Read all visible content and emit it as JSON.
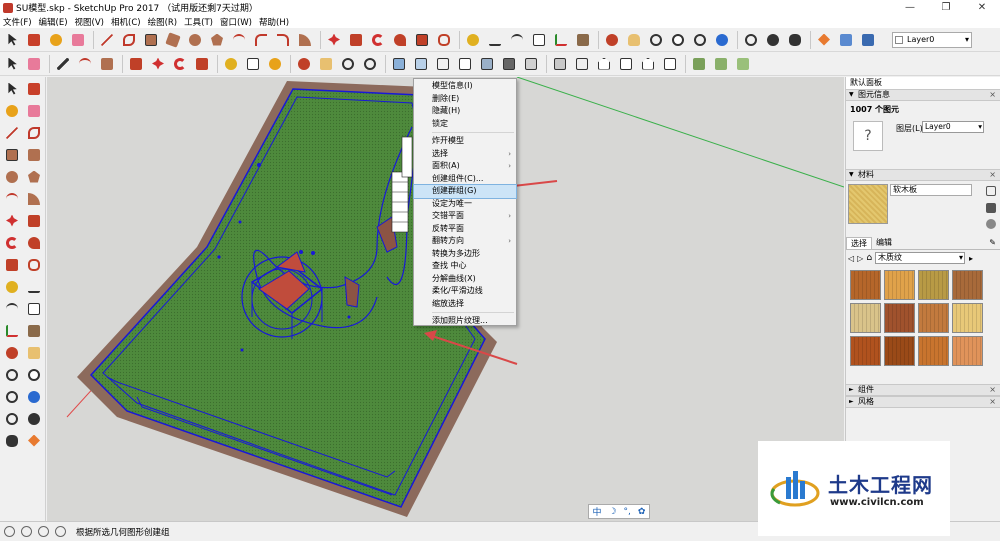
{
  "window": {
    "title": "SU模型.skp - SketchUp Pro 2017 （试用版还剩7天过期）",
    "controls": [
      "—",
      "❐",
      "✕"
    ]
  },
  "menubar": [
    "文件(F)",
    "编辑(E)",
    "视图(V)",
    "相机(C)",
    "绘图(R)",
    "工具(T)",
    "窗口(W)",
    "帮助(H)"
  ],
  "toolbar": {
    "layer_value": "Layer0"
  },
  "context_menu": {
    "items": [
      {
        "label": "模型信息(I)",
        "submenu": false
      },
      {
        "label": "删除(E)",
        "submenu": false
      },
      {
        "label": "隐藏(H)",
        "submenu": false
      },
      {
        "label": "锁定",
        "submenu": false
      },
      {
        "label": "炸开模型",
        "submenu": false
      },
      {
        "label": "选择",
        "submenu": true
      },
      {
        "label": "面积(A)",
        "submenu": true
      },
      {
        "label": "创建组件(C)...",
        "submenu": false
      },
      {
        "label": "创建群组(G)",
        "submenu": false
      },
      {
        "label": "设定为唯一",
        "submenu": false
      },
      {
        "label": "交错平面",
        "submenu": true
      },
      {
        "label": "反转平面",
        "submenu": false
      },
      {
        "label": "翻转方向",
        "submenu": true
      },
      {
        "label": "转换为多边形",
        "submenu": false
      },
      {
        "label": "查找 中心",
        "submenu": false
      },
      {
        "label": "分解曲线(X)",
        "submenu": false
      },
      {
        "label": "柔化/平滑边线",
        "submenu": false
      },
      {
        "label": "缩放选择",
        "submenu": false
      },
      {
        "label": "添加照片纹理...",
        "submenu": false
      }
    ],
    "highlighted": "创建群组(G)",
    "submenu_arrow": "›"
  },
  "tray": {
    "title": "默认面板",
    "entity_info": {
      "header": "图元信息",
      "count": "1007 个图元",
      "placeholder_icon": "?",
      "layer_label": "图层(L):",
      "layer_value": "Layer0"
    },
    "materials": {
      "header": "材料",
      "current_name": "软木板",
      "tab_select": "选择",
      "tab_edit": "编辑",
      "library": "木质纹",
      "swatches": [
        "#b5662a",
        "#e0a24a",
        "#b89a45",
        "#a86a3a",
        "#d9c38a",
        "#a0522d",
        "#c27a3e",
        "#e8c878",
        "#b0521e",
        "#9a4a18",
        "#c8742e",
        "#e0935a"
      ]
    },
    "collapsed_panels": [
      "组件",
      "风格"
    ],
    "close_glyph": "×"
  },
  "statusbar": {
    "message": "根据所选几何图形创建组"
  },
  "ime": {
    "lang": "中",
    "moon": "☽",
    "punct": "°,",
    "gear": "✿"
  },
  "watermark": {
    "name": "土木工程网",
    "url": "www.civilcn.com"
  },
  "colors": {
    "ground": "#4e8a3c",
    "outline": "#1818d8",
    "border_strip": "#8c6a5c",
    "highlight": "#cce4f7",
    "arrow_red": "#d94848",
    "watermark_blue": "#1e3a8a"
  }
}
